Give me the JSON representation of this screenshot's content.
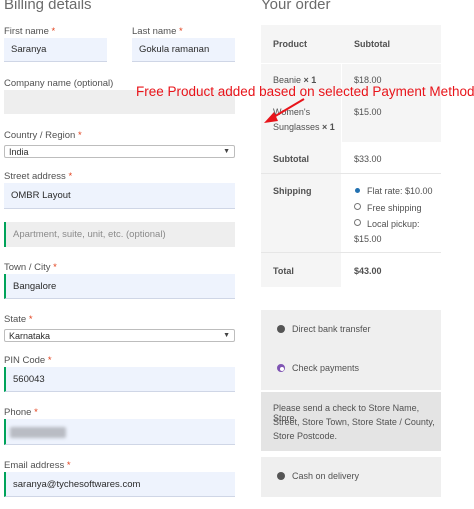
{
  "billing": {
    "title": "Billing details",
    "required_mark": "*",
    "first_name": {
      "label": "First name",
      "value": "Saranya"
    },
    "last_name": {
      "label": "Last name",
      "value": "Gokula ramanan"
    },
    "company": {
      "label": "Company name (optional)",
      "value": ""
    },
    "country": {
      "label": "Country / Region",
      "value": "India"
    },
    "street": {
      "label": "Street address",
      "value": "OMBR Layout",
      "placeholder2": "Apartment, suite, unit, etc. (optional)"
    },
    "town": {
      "label": "Town / City",
      "value": "Bangalore"
    },
    "state": {
      "label": "State",
      "value": "Karnataka"
    },
    "pin": {
      "label": "PIN Code",
      "value": "560043"
    },
    "phone": {
      "label": "Phone",
      "value": ""
    },
    "email": {
      "label": "Email address",
      "value": "saranya@tychesoftwares.com"
    }
  },
  "order": {
    "title": "Your order",
    "col_product": "Product",
    "col_subtotal": "Subtotal",
    "items": [
      {
        "name": "Beanie",
        "qty": "× 1",
        "price": "$18.00"
      },
      {
        "name_line1": "Women's",
        "name_line2": "Sunglasses",
        "qty": "× 1",
        "price": "$15.00"
      }
    ],
    "subtotal_label": "Subtotal",
    "subtotal_value": "$33.00",
    "shipping_label": "Shipping",
    "shipping_options": [
      {
        "label": "Flat rate: $10.00",
        "selected": true
      },
      {
        "label": "Free shipping",
        "selected": false
      },
      {
        "label": "Local pickup:",
        "extra": "$15.00",
        "selected": false
      }
    ],
    "total_label": "Total",
    "total_value": "$43.00"
  },
  "payment": {
    "methods": [
      {
        "label": "Direct bank transfer",
        "selected": false
      },
      {
        "label": "Check payments",
        "selected": true
      },
      {
        "label": "Cash on delivery",
        "selected": false
      }
    ],
    "check_desc": [
      "Please send a check to Store Name, Store",
      "Street, Store Town, Store State / County,",
      "Store Postcode."
    ]
  },
  "annotation": {
    "text": "Free Product added based on selected Payment Method",
    "color": "#e8141a"
  },
  "colors": {
    "accent_radio": "#7f54b3",
    "required": "#e2401c",
    "field_bg": "#eef3fd",
    "valid_border": "#00a35a"
  }
}
